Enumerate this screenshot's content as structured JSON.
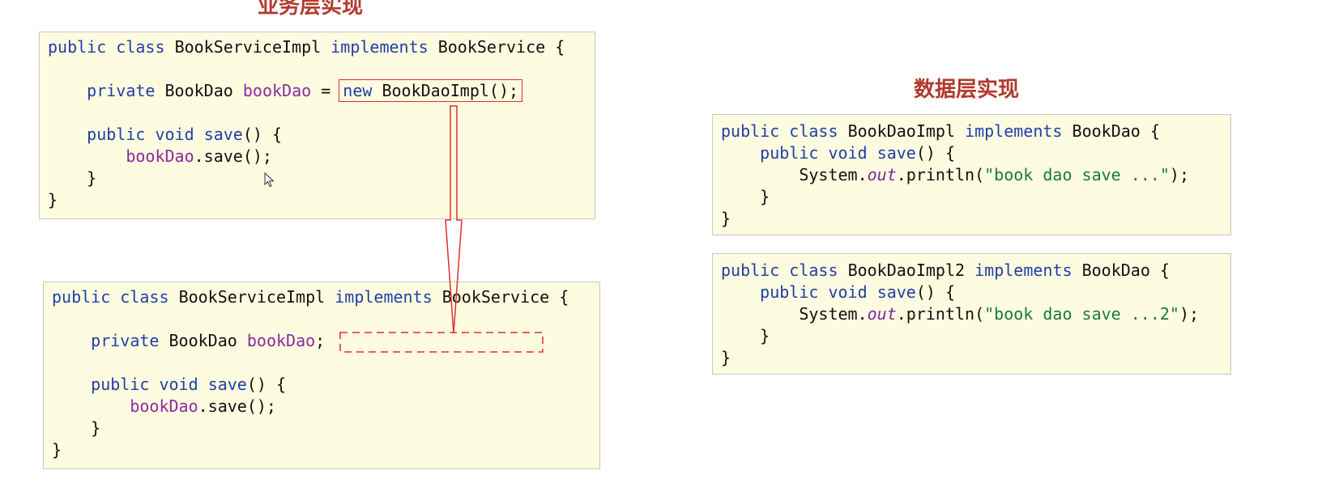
{
  "titles": {
    "business": "业务层实现",
    "data": "数据层实现"
  },
  "service_a": {
    "l1_kw1": "public",
    "l1_kw2": "class",
    "l1_cls": "BookServiceImpl",
    "l1_kw3": "implements",
    "l1_cls2": "BookService",
    "l1_brace": "{",
    "l2_kw": "private",
    "l2_type": "BookDao",
    "l2_field": "bookDao",
    "l2_eq": "=",
    "l2_new": "new",
    "l2_ctor": "BookDaoImpl();",
    "l3_kw1": "public",
    "l3_kw2": "void",
    "l3_method": "save",
    "l3_rest": "() {",
    "l4_field": "bookDao",
    "l4_rest": ".save();",
    "l5": "}",
    "l6": "}"
  },
  "service_b": {
    "l1_kw1": "public",
    "l1_kw2": "class",
    "l1_cls": "BookServiceImpl",
    "l1_kw3": "implements",
    "l1_cls2": "BookService",
    "l1_brace": "{",
    "l2_kw": "private",
    "l2_type": "BookDao",
    "l2_field": "bookDao",
    "l2_semi": ";",
    "l3_kw1": "public",
    "l3_kw2": "void",
    "l3_method": "save",
    "l3_rest": "() {",
    "l4_field": "bookDao",
    "l4_rest": ".save();",
    "l5": "}",
    "l6": "}"
  },
  "dao_1": {
    "l1_kw1": "public",
    "l1_kw2": "class",
    "l1_cls": "BookDaoImpl",
    "l1_kw3": "implements",
    "l1_cls2": "BookDao",
    "l1_brace": "{",
    "l2_kw1": "public",
    "l2_kw2": "void",
    "l2_method": "save",
    "l2_rest": "() {",
    "l3_sys": "System.",
    "l3_out": "out",
    "l3_call": ".println(",
    "l3_str": "\"book dao save ...\"",
    "l3_end": ");",
    "l4": "}",
    "l5": "}"
  },
  "dao_2": {
    "l1_kw1": "public",
    "l1_kw2": "class",
    "l1_cls": "BookDaoImpl2",
    "l1_kw3": "implements",
    "l1_cls2": "BookDao",
    "l1_brace": "{",
    "l2_kw1": "public",
    "l2_kw2": "void",
    "l2_method": "save",
    "l2_rest": "() {",
    "l3_sys": "System.",
    "l3_out": "out",
    "l3_call": ".println(",
    "l3_str": "\"book dao save ...2\"",
    "l3_end": ");",
    "l4": "}",
    "l5": "}"
  },
  "colors": {
    "title": "#b23a2e",
    "keyword": "#1f3fa8",
    "field": "#8a2ba2",
    "string": "#1c7a3a",
    "box_bg": "#fdfbe0",
    "highlight": "#e03030"
  }
}
